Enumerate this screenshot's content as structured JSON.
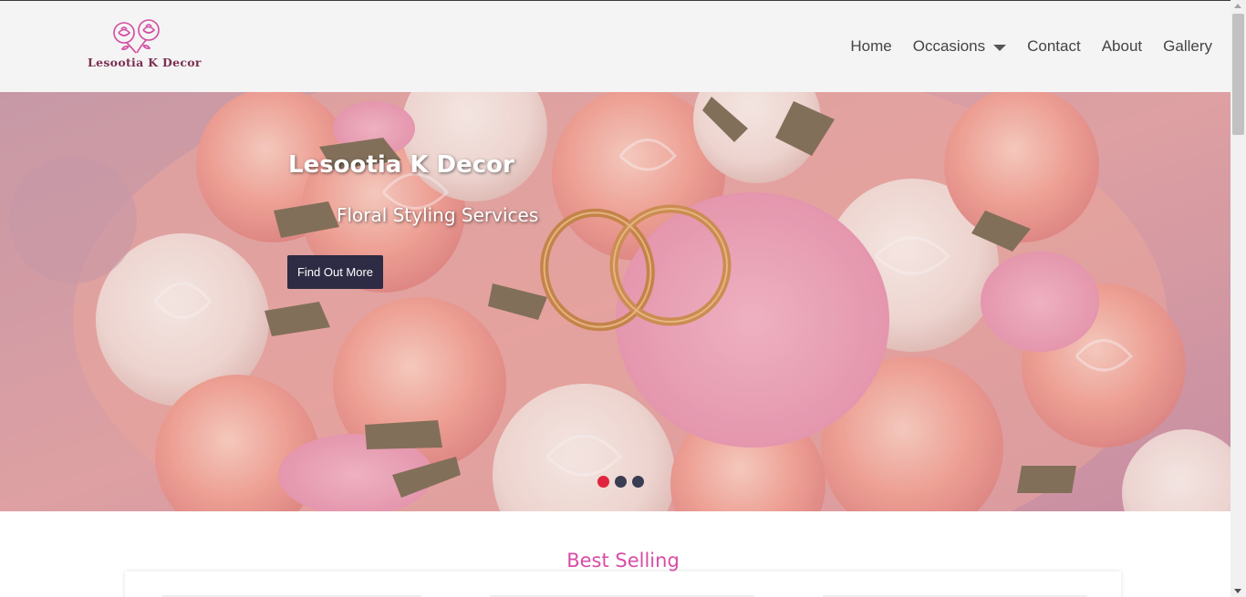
{
  "brand": {
    "name": "Lesootia K Decor",
    "logo_icon": "roses-icon",
    "logo_color": "#d24aa0"
  },
  "nav": {
    "items": [
      {
        "label": "Home"
      },
      {
        "label": "Occasions",
        "has_dropdown": true
      },
      {
        "label": "Contact"
      },
      {
        "label": "About"
      },
      {
        "label": "Gallery"
      }
    ]
  },
  "hero": {
    "title": "Lesootia K Decor",
    "subtitle": "Floral Styling Services",
    "cta_label": "Find Out More",
    "cta_color": "#2e2b45",
    "slides": 3,
    "active_slide": 1,
    "active_dot_color": "#e0243d"
  },
  "best_selling": {
    "title": "Best Selling",
    "title_color": "#d84ca6"
  }
}
